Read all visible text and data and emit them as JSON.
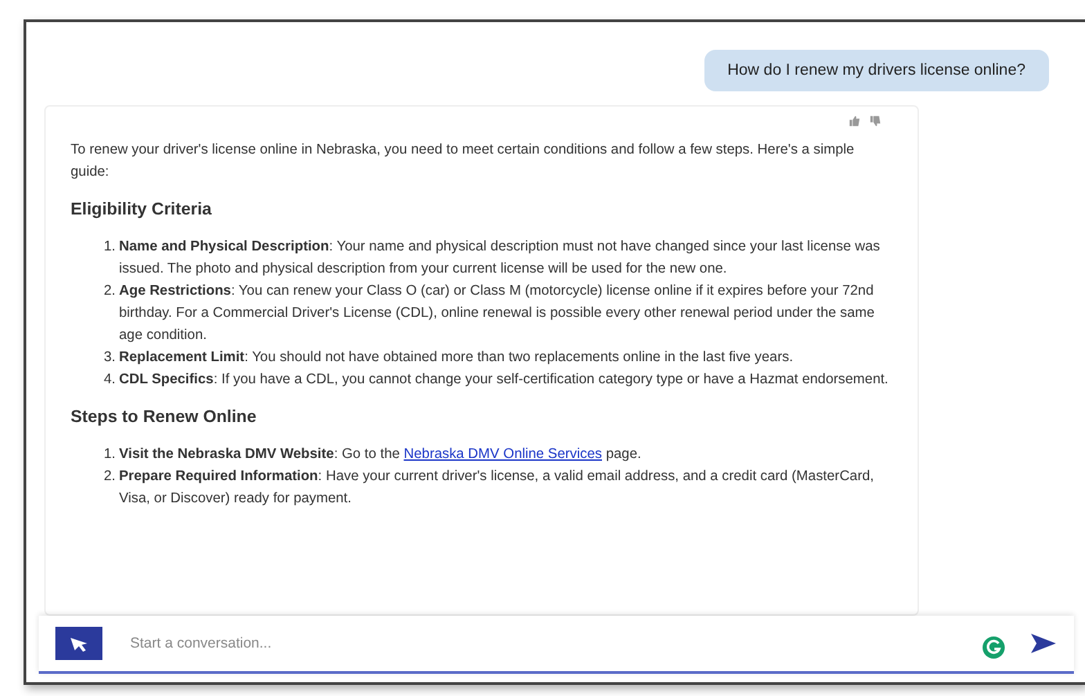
{
  "user_message": {
    "text": "How do I renew my drivers license online?"
  },
  "reply": {
    "intro": "To renew your driver's license online in Nebraska, you need to meet certain conditions and follow a few steps. Here's a simple guide:",
    "sections": [
      {
        "heading": "Eligibility Criteria",
        "items": [
          {
            "number": "1.",
            "text": "**Name and Physical Description**: Your name and physical description must not have changed since your last license was issued. The photo and physical description from your current license will be used for the new one."
          },
          {
            "number": "2.",
            "text": "**Age Restrictions**: You can renew your Class O (car) or Class M (motorcycle) license online if it expires before your 72nd birthday. For a Commercial Driver's License (CDL), online renewal is possible every other renewal period under the same age condition."
          },
          {
            "number": "3.",
            "text": "**Replacement Limit**: You should not have obtained more than two replacements online in the last five years."
          },
          {
            "number": "4.",
            "text": "**CDL Specifics**: If you have a CDL, you cannot change your self-certification category type or have a Hazmat endorsement."
          }
        ]
      },
      {
        "heading": "Steps to Renew Online",
        "items": [
          {
            "number": "1.",
            "text": "**Visit the Nebraska DMV Website**: Go to the",
            "link": "Nebraska DMV Online Services",
            "after": "page."
          },
          {
            "number": "2.",
            "text": "**Prepare Required Information**: Have your current driver's license, a valid email address, and a credit card (MasterCard, Visa, or Discover) ready for payment."
          }
        ]
      }
    ]
  },
  "composer": {
    "placeholder": "Start a conversation..."
  }
}
